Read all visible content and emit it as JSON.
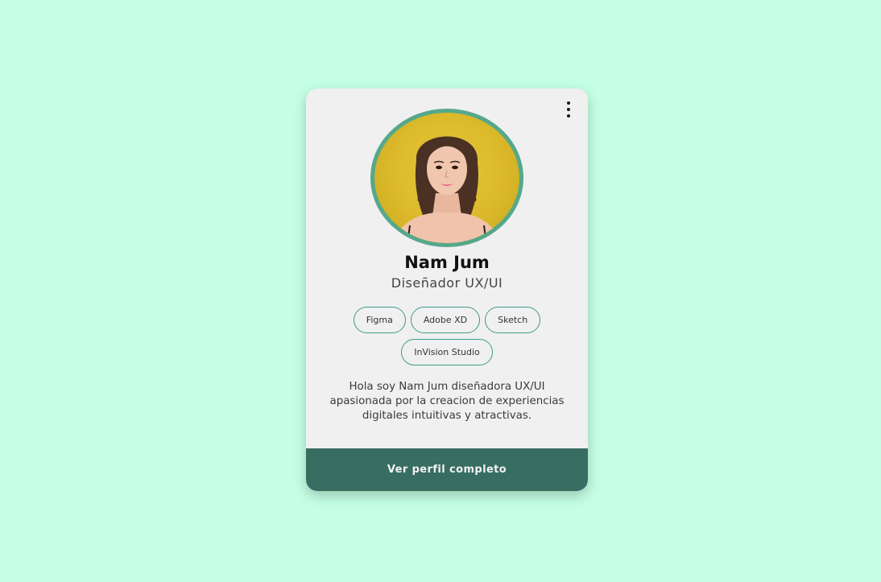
{
  "card": {
    "name": "Nam Jum",
    "role": "Diseñador UX/UI",
    "skills": [
      "Figma",
      "Adobe XD",
      "Sketch",
      "InVision Studio"
    ],
    "bio": "Hola soy Nam Jum diseñadora UX/UI apasionada por la creacion de experiencias digitales intuitivas y atractivas.",
    "cta_label": "Ver perfil completo",
    "menu_icon": "more-vertical-icon"
  },
  "colors": {
    "page_background": "#c4ffe4",
    "card_background": "#f0f0f0",
    "avatar_ring": "#56a88a",
    "chip_border": "#3e9a8c",
    "cta_background": "#386e62"
  }
}
